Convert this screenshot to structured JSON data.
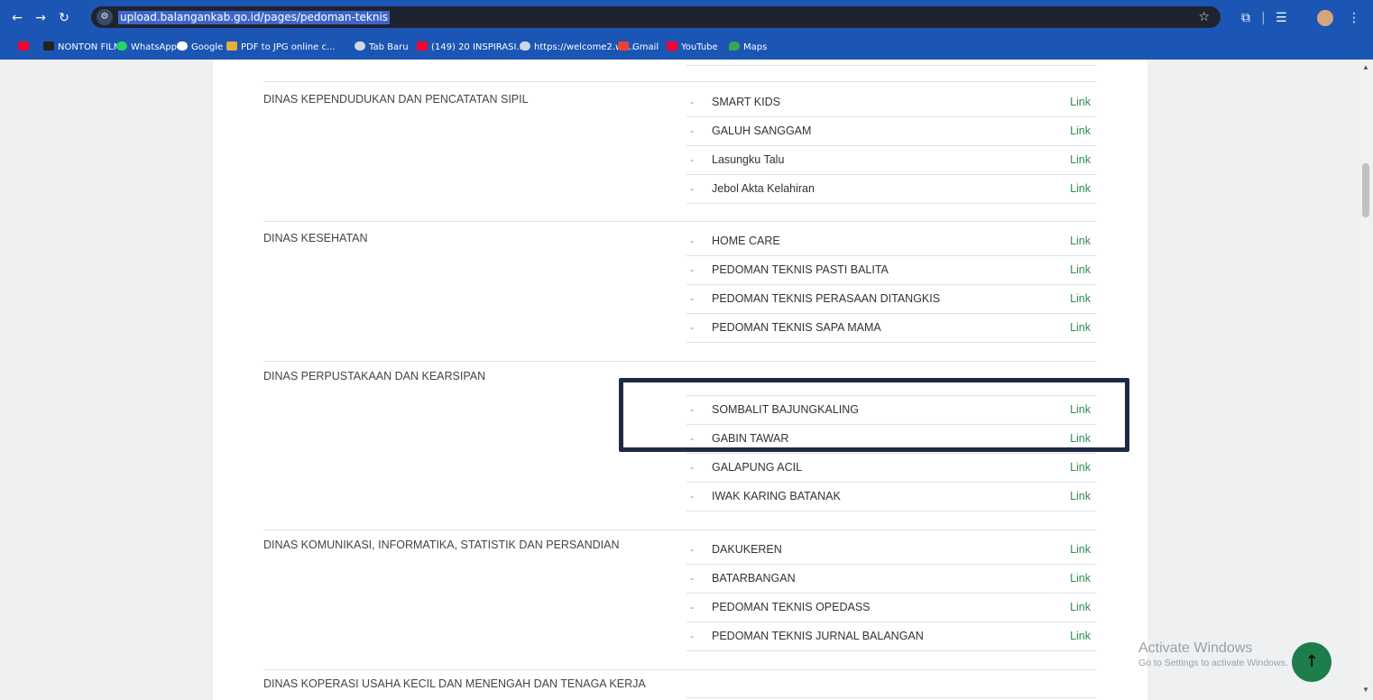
{
  "browser": {
    "url": "upload.balangankab.go.id/pages/pedoman-teknis",
    "bookmarks": [
      {
        "label": "",
        "icon": "youtube-icon"
      },
      {
        "label": "NONTON FILM",
        "icon": "film-icon"
      },
      {
        "label": "WhatsApp",
        "icon": "whatsapp-icon"
      },
      {
        "label": "Google",
        "icon": "google-icon"
      },
      {
        "label": "PDF to JPG online c...",
        "icon": "pdf-icon"
      },
      {
        "label": "Tab Baru",
        "icon": "globe-icon"
      },
      {
        "label": "(149) 20 INSPIRASI...",
        "icon": "youtube-icon"
      },
      {
        "label": "https://welcome2.wi...",
        "icon": "globe-icon"
      },
      {
        "label": "Gmail",
        "icon": "gmail-icon"
      },
      {
        "label": "YouTube",
        "icon": "youtube-icon"
      },
      {
        "label": "Maps",
        "icon": "maps-icon"
      }
    ]
  },
  "link_color": "#2e8b57",
  "sections": [
    {
      "dept": "DINAS KEPENDUDUKAN DAN PENCATATAN SIPIL",
      "items": [
        {
          "name": "SMART KIDS",
          "link": "Link"
        },
        {
          "name": "GALUH SANGGAM",
          "link": "Link"
        },
        {
          "name": "Lasungku Talu",
          "link": "Link"
        },
        {
          "name": "Jebol Akta Kelahiran",
          "link": "Link"
        }
      ]
    },
    {
      "dept": "DINAS KESEHATAN",
      "items": [
        {
          "name": "HOME CARE",
          "link": "Link"
        },
        {
          "name": "PEDOMAN TEKNIS PASTI BALITA",
          "link": "Link"
        },
        {
          "name": "PEDOMAN TEKNIS PERASAAN DITANGKIS",
          "link": "Link"
        },
        {
          "name": "PEDOMAN TEKNIS SAPA MAMA",
          "link": "Link"
        }
      ]
    },
    {
      "dept": "DINAS PERPUSTAKAAN DAN KEARSIPAN",
      "items": [
        {
          "name": "",
          "link": ""
        },
        {
          "name": "SOMBALIT BAJUNGKALING",
          "link": "Link"
        },
        {
          "name": "GABIN TAWAR",
          "link": "Link"
        },
        {
          "name": "GALAPUNG ACIL",
          "link": "Link"
        },
        {
          "name": "IWAK KARING BATANAK",
          "link": "Link"
        }
      ]
    },
    {
      "dept": "DINAS KOMUNIKASI, INFORMATIKA, STATISTIK DAN PERSANDIAN",
      "items": [
        {
          "name": "DAKUKEREN",
          "link": "Link"
        },
        {
          "name": "BATARBANGAN",
          "link": "Link"
        },
        {
          "name": "PEDOMAN TEKNIS OPEDASS",
          "link": "Link"
        },
        {
          "name": "PEDOMAN TEKNIS JURNAL BALANGAN",
          "link": "Link"
        }
      ]
    },
    {
      "dept": "DINAS KOPERASI USAHA KECIL DAN MENENGAH DAN TENAGA KERJA",
      "items": []
    }
  ],
  "watermark": {
    "title": "Activate Windows",
    "subtitle": "Go to Settings to activate Windows."
  }
}
